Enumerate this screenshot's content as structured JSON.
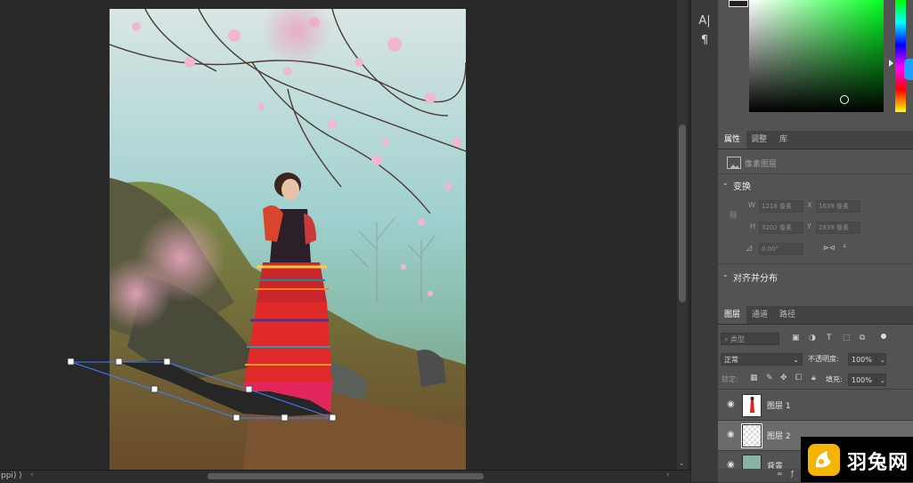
{
  "tools": {
    "text_tool": "A|",
    "paragraph_tool": "¶"
  },
  "statusbar": {
    "doc_info": "ppi)  ⟩"
  },
  "properties": {
    "tabs": [
      "属性",
      "调整",
      "库"
    ],
    "layer_type": "像素图层",
    "transform_title": "变换",
    "w_label": "W",
    "w_value": "1218 像素",
    "x_label": "X",
    "x_value": "1639 像素",
    "h_label": "H",
    "h_value": "3202 像素",
    "y_label": "Y",
    "y_value": "2839 像素",
    "angle_value": "0.00°",
    "align_title": "对齐并分布"
  },
  "layers_panel": {
    "tabs": [
      "图层",
      "通道",
      "路径"
    ],
    "filter_placeholder": "类型",
    "blend_mode": "正常",
    "opacity_label": "不透明度:",
    "opacity_value": "100%",
    "lock_label": "锁定:",
    "fill_label": "填充:",
    "fill_value": "100%",
    "layers": [
      {
        "name": "图层 1"
      },
      {
        "name": "图层 2"
      },
      {
        "name": "背景"
      }
    ]
  },
  "watermark": {
    "text": "羽兔网"
  },
  "colors": {
    "accent": "#1ea0ff",
    "panel_bg": "#535353",
    "canvas_bg": "#282828",
    "logo": "#f5b400"
  }
}
